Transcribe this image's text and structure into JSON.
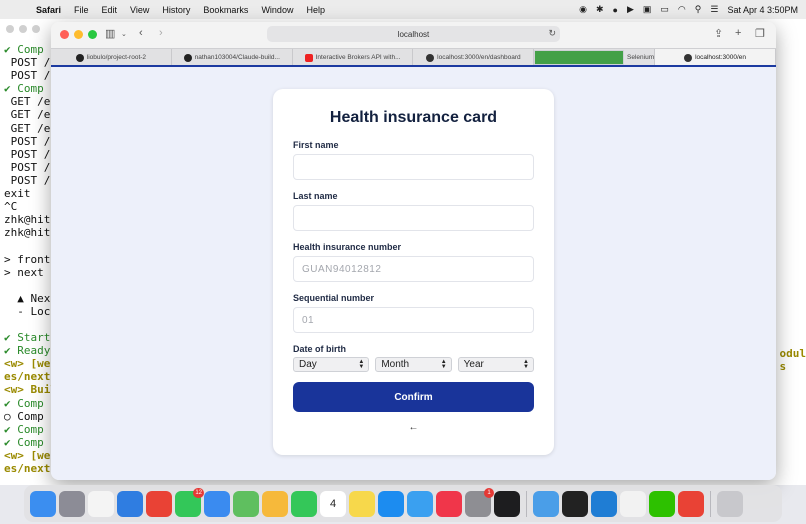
{
  "menubar": {
    "app": "Safari",
    "items": [
      "File",
      "Edit",
      "View",
      "History",
      "Bookmarks",
      "Window",
      "Help"
    ],
    "clock": "Sat Apr 4  3:50PM"
  },
  "terminal": {
    "lines": [
      {
        "t": "✔ Comp",
        "c": "g"
      },
      {
        "t": " POST /",
        "c": ""
      },
      {
        "t": " POST /",
        "c": ""
      },
      {
        "t": "✔ Comp",
        "c": "g"
      },
      {
        "t": " GET /e",
        "c": ""
      },
      {
        "t": " GET /e",
        "c": ""
      },
      {
        "t": " GET /e",
        "c": ""
      },
      {
        "t": " POST /",
        "c": ""
      },
      {
        "t": " POST /",
        "c": ""
      },
      {
        "t": " POST /",
        "c": ""
      },
      {
        "t": " POST /",
        "c": ""
      },
      {
        "t": "exit",
        "c": ""
      },
      {
        "t": "^C",
        "c": ""
      },
      {
        "t": "zhk@hit",
        "c": ""
      },
      {
        "t": "zhk@hit",
        "c": ""
      },
      {
        "t": "",
        "c": ""
      },
      {
        "t": "> front",
        "c": ""
      },
      {
        "t": "> next",
        "c": ""
      },
      {
        "t": "",
        "c": ""
      },
      {
        "t": "  ▲ Next",
        "c": ""
      },
      {
        "t": "  - Loca",
        "c": ""
      },
      {
        "t": "",
        "c": ""
      },
      {
        "t": "✔ Start",
        "c": "g"
      },
      {
        "t": "✔ Ready",
        "c": "g"
      },
      {
        "t": "<w> [web",
        "c": "y"
      },
      {
        "t": "es/next",
        "c": "y"
      },
      {
        "t": "<w> Buil",
        "c": "y"
      },
      {
        "t": "✔ Comp",
        "c": "g"
      },
      {
        "t": "○ Comp",
        "c": ""
      },
      {
        "t": "✔ Comp",
        "c": "g"
      },
      {
        "t": "✔ Comp",
        "c": "g"
      },
      {
        "t": "<w> [web",
        "c": "y"
      },
      {
        "t": "es/next",
        "c": "y"
      }
    ],
    "right_lines": [
      "odul",
      "s"
    ]
  },
  "browser": {
    "url": "localhost",
    "tabs": [
      {
        "label": "liobulo/project-root-2",
        "icon": "gh"
      },
      {
        "label": "nathan103004/Claude-build...",
        "icon": "gh"
      },
      {
        "label": "Interactive Brokers API with...",
        "icon": "yt"
      },
      {
        "label": "localhost:3000/en/dashboard",
        "icon": "dot"
      },
      {
        "label": "Selenium",
        "icon": "sel"
      },
      {
        "label": "localhost:3000/en",
        "icon": "dot",
        "active": true
      }
    ]
  },
  "form": {
    "title": "Health insurance card",
    "first_name_label": "First name",
    "first_name_value": "",
    "last_name_label": "Last name",
    "last_name_value": "",
    "hin_label": "Health insurance number",
    "hin_placeholder": "GUAN94012812",
    "seq_label": "Sequential number",
    "seq_placeholder": "01",
    "dob_label": "Date of birth",
    "day": "Day",
    "month": "Month",
    "year": "Year",
    "confirm_label": "Confirm",
    "back_label": "←"
  },
  "dock": {
    "apps": [
      {
        "name": "finder",
        "color": "#3b8ef0"
      },
      {
        "name": "launchpad",
        "color": "#8c8c96"
      },
      {
        "name": "reminders",
        "color": "#f4f4f4"
      },
      {
        "name": "safari",
        "color": "#2f7de1"
      },
      {
        "name": "chrome",
        "color": "#e94235"
      },
      {
        "name": "messages",
        "color": "#33c759",
        "badge": "12"
      },
      {
        "name": "mail",
        "color": "#3a8bf0"
      },
      {
        "name": "maps",
        "color": "#5fbf5f"
      },
      {
        "name": "photos",
        "color": "#f6b93b"
      },
      {
        "name": "facetime",
        "color": "#34c759"
      },
      {
        "name": "calendar",
        "color": "#ffffff",
        "text": "4"
      },
      {
        "name": "notes",
        "color": "#f7d84b"
      },
      {
        "name": "app-store",
        "color": "#1c8cf0"
      },
      {
        "name": "freeform",
        "color": "#3aa0f0"
      },
      {
        "name": "news",
        "color": "#f0364a"
      },
      {
        "name": "system-settings",
        "color": "#8e8e93",
        "badge": "1"
      },
      {
        "name": "activity",
        "color": "#1d1d1f"
      },
      {
        "name": "preview",
        "color": "#4a9ee8"
      },
      {
        "name": "terminal",
        "color": "#222"
      },
      {
        "name": "vscode",
        "color": "#1f7dd4"
      },
      {
        "name": "textedit",
        "color": "#f2f2f2"
      },
      {
        "name": "wechat",
        "color": "#2dc100"
      },
      {
        "name": "chrome-2",
        "color": "#e94235"
      },
      {
        "name": "trash",
        "color": "#c8c8cc"
      }
    ]
  }
}
